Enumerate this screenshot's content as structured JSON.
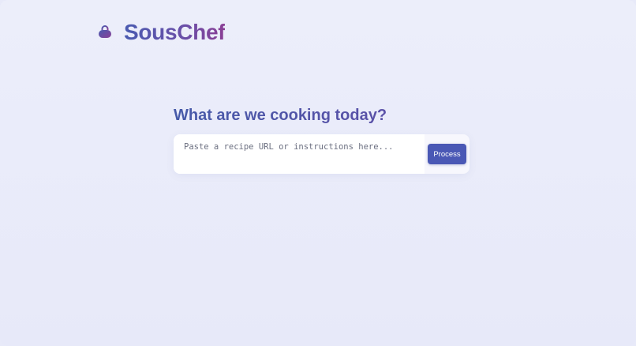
{
  "brand": {
    "name": "SousChef",
    "icon": "cooking-pot-icon"
  },
  "main": {
    "heading": "What are we cooking today?",
    "input": {
      "placeholder": "Paste a recipe URL or instructions here...",
      "value": ""
    },
    "process_label": "Process"
  },
  "colors": {
    "background": "#e8eaf9",
    "accent": "#4a58b5",
    "brand_gradient_start": "#4a5bb0",
    "brand_gradient_end": "#8a3f95"
  }
}
